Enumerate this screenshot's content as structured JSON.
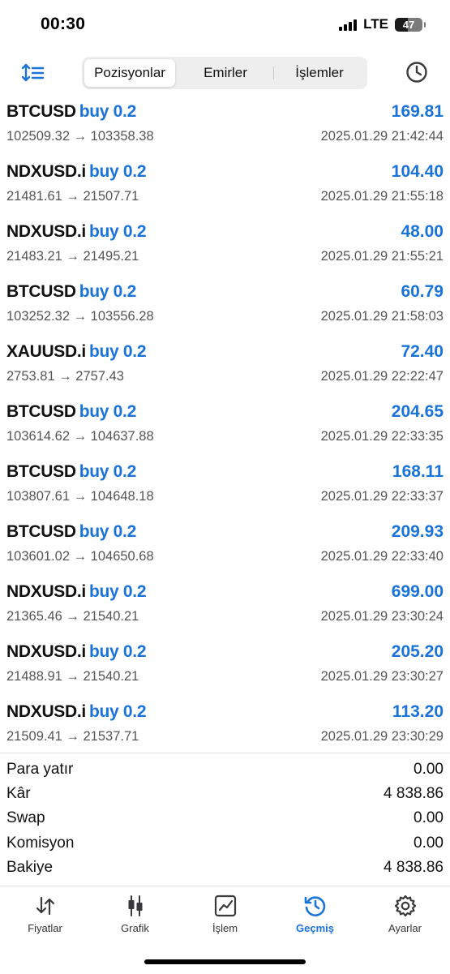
{
  "status_bar": {
    "time": "00:30",
    "network": "LTE",
    "battery": "47",
    "battery_level": 0.47
  },
  "tabs_top": [
    {
      "label": "Pozisyonlar",
      "active": true
    },
    {
      "label": "Emirler",
      "active": false
    },
    {
      "label": "İşlemler",
      "active": false
    }
  ],
  "trades": [
    {
      "symbol": "BTCUSD",
      "side": "buy 0.2",
      "profit": "169.81",
      "prices": "102509.32 → 103358.38",
      "time": "2025.01.29 21:42:44"
    },
    {
      "symbol": "NDXUSD.i",
      "side": "buy 0.2",
      "profit": "104.40",
      "prices": "21481.61 → 21507.71",
      "time": "2025.01.29 21:55:18"
    },
    {
      "symbol": "NDXUSD.i",
      "side": "buy 0.2",
      "profit": "48.00",
      "prices": "21483.21 → 21495.21",
      "time": "2025.01.29 21:55:21"
    },
    {
      "symbol": "BTCUSD",
      "side": "buy 0.2",
      "profit": "60.79",
      "prices": "103252.32 → 103556.28",
      "time": "2025.01.29 21:58:03"
    },
    {
      "symbol": "XAUUSD.i",
      "side": "buy 0.2",
      "profit": "72.40",
      "prices": "2753.81 → 2757.43",
      "time": "2025.01.29 22:22:47"
    },
    {
      "symbol": "BTCUSD",
      "side": "buy 0.2",
      "profit": "204.65",
      "prices": "103614.62 → 104637.88",
      "time": "2025.01.29 22:33:35"
    },
    {
      "symbol": "BTCUSD",
      "side": "buy 0.2",
      "profit": "168.11",
      "prices": "103807.61 → 104648.18",
      "time": "2025.01.29 22:33:37"
    },
    {
      "symbol": "BTCUSD",
      "side": "buy 0.2",
      "profit": "209.93",
      "prices": "103601.02 → 104650.68",
      "time": "2025.01.29 22:33:40"
    },
    {
      "symbol": "NDXUSD.i",
      "side": "buy 0.2",
      "profit": "699.00",
      "prices": "21365.46 → 21540.21",
      "time": "2025.01.29 23:30:24"
    },
    {
      "symbol": "NDXUSD.i",
      "side": "buy 0.2",
      "profit": "205.20",
      "prices": "21488.91 → 21540.21",
      "time": "2025.01.29 23:30:27"
    },
    {
      "symbol": "NDXUSD.i",
      "side": "buy 0.2",
      "profit": "113.20",
      "prices": "21509.41 → 21537.71",
      "time": "2025.01.29 23:30:29"
    }
  ],
  "summary": [
    {
      "label": "Para yatır",
      "value": "0.00"
    },
    {
      "label": "Kâr",
      "value": "4 838.86"
    },
    {
      "label": "Swap",
      "value": "0.00"
    },
    {
      "label": "Komisyon",
      "value": "0.00"
    },
    {
      "label": "Bakiye",
      "value": "4 838.86"
    }
  ],
  "bottom_tabs": [
    {
      "label": "Fiyatlar",
      "icon": "arrows-updown-icon",
      "active": false
    },
    {
      "label": "Grafik",
      "icon": "candlestick-icon",
      "active": false
    },
    {
      "label": "İşlem",
      "icon": "trade-chart-icon",
      "active": false
    },
    {
      "label": "Geçmiş",
      "icon": "history-clock-icon",
      "active": true
    },
    {
      "label": "Ayarlar",
      "icon": "gear-icon",
      "active": false
    }
  ],
  "colors": {
    "accent": "#1a73d9",
    "text": "#111111",
    "secondary": "#555555"
  }
}
